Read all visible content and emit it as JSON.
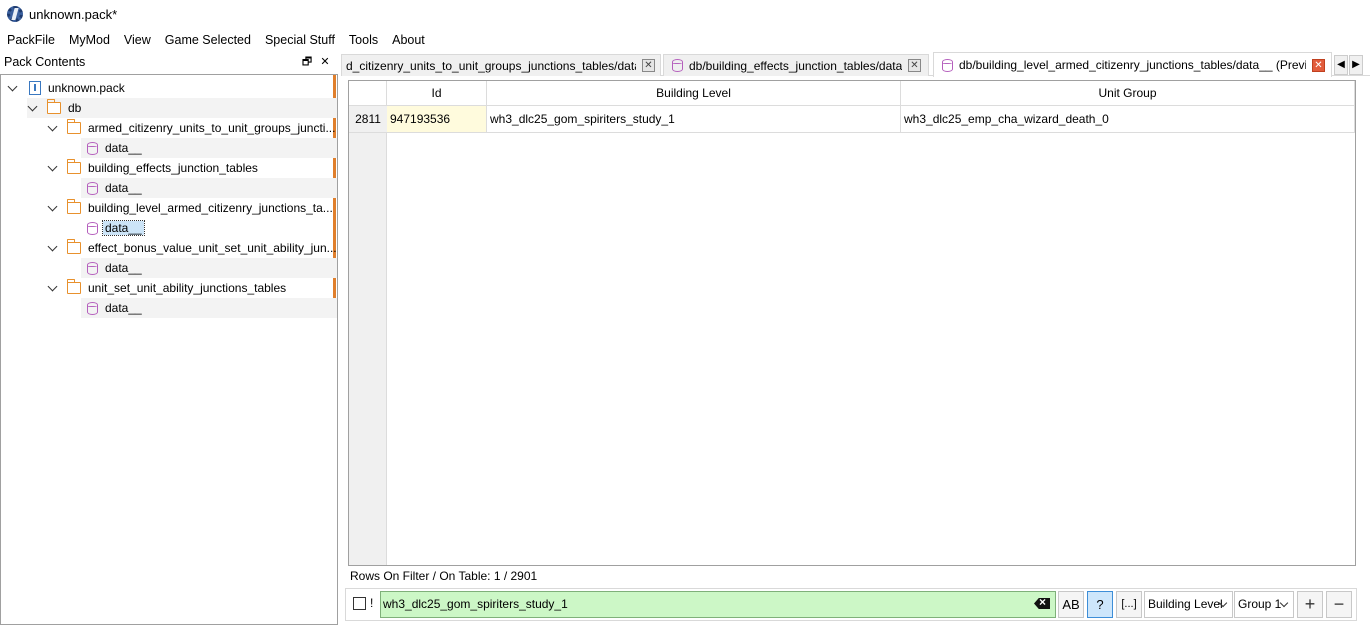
{
  "window": {
    "title": "unknown.pack*"
  },
  "menu": [
    "PackFile",
    "MyMod",
    "View",
    "Game Selected",
    "Special Stuff",
    "Tools",
    "About"
  ],
  "dock": {
    "title": "Pack Contents",
    "float_glyph": "🗗",
    "close_glyph": "✕"
  },
  "tree": {
    "root": "unknown.pack",
    "db": "db",
    "folders": [
      {
        "name": "armed_citizenry_units_to_unit_groups_juncti...",
        "file": "data__"
      },
      {
        "name": "building_effects_junction_tables",
        "file": "data__"
      },
      {
        "name": "building_level_armed_citizenry_junctions_ta...",
        "file": "data__"
      },
      {
        "name": "effect_bonus_value_unit_set_unit_ability_jun...",
        "file": "data__"
      },
      {
        "name": "unit_set_unit_ability_junctions_tables",
        "file": "data__"
      }
    ]
  },
  "tabs": [
    {
      "label": "d_citizenry_units_to_unit_groups_junctions_tables/data__"
    },
    {
      "label": "db/building_effects_junction_tables/data__"
    },
    {
      "label": "db/building_level_armed_citizenry_junctions_tables/data__ (Preview)"
    }
  ],
  "tab_scroll": {
    "left": "◀",
    "right": "▶"
  },
  "table": {
    "columns": [
      "Id",
      "Building Level",
      "Unit Group"
    ],
    "rows": [
      {
        "num": "2811",
        "id": "947193536",
        "building_level": "wh3_dlc25_gom_spiriters_study_1",
        "unit_group": "wh3_dlc25_emp_cha_wizard_death_0"
      }
    ]
  },
  "status": {
    "rows_text": "Rows On Filter / On Table: 1 / 2901"
  },
  "filter": {
    "not_label": "!",
    "value": "wh3_dlc25_gom_spiriters_study_1",
    "case_btn": "AB",
    "regex_btn": "?",
    "bracket_btn": "[...]",
    "column_select": "Building Level",
    "group_select": "Group 1",
    "add_btn": "+",
    "remove_btn": "−"
  },
  "colors": {
    "filter_match": "#ccf7c6",
    "id_cell": "#fffbdd",
    "tree_accent": "#e07f2c",
    "db_icon": "#b55fbd",
    "folder_icon": "#e8912d"
  }
}
